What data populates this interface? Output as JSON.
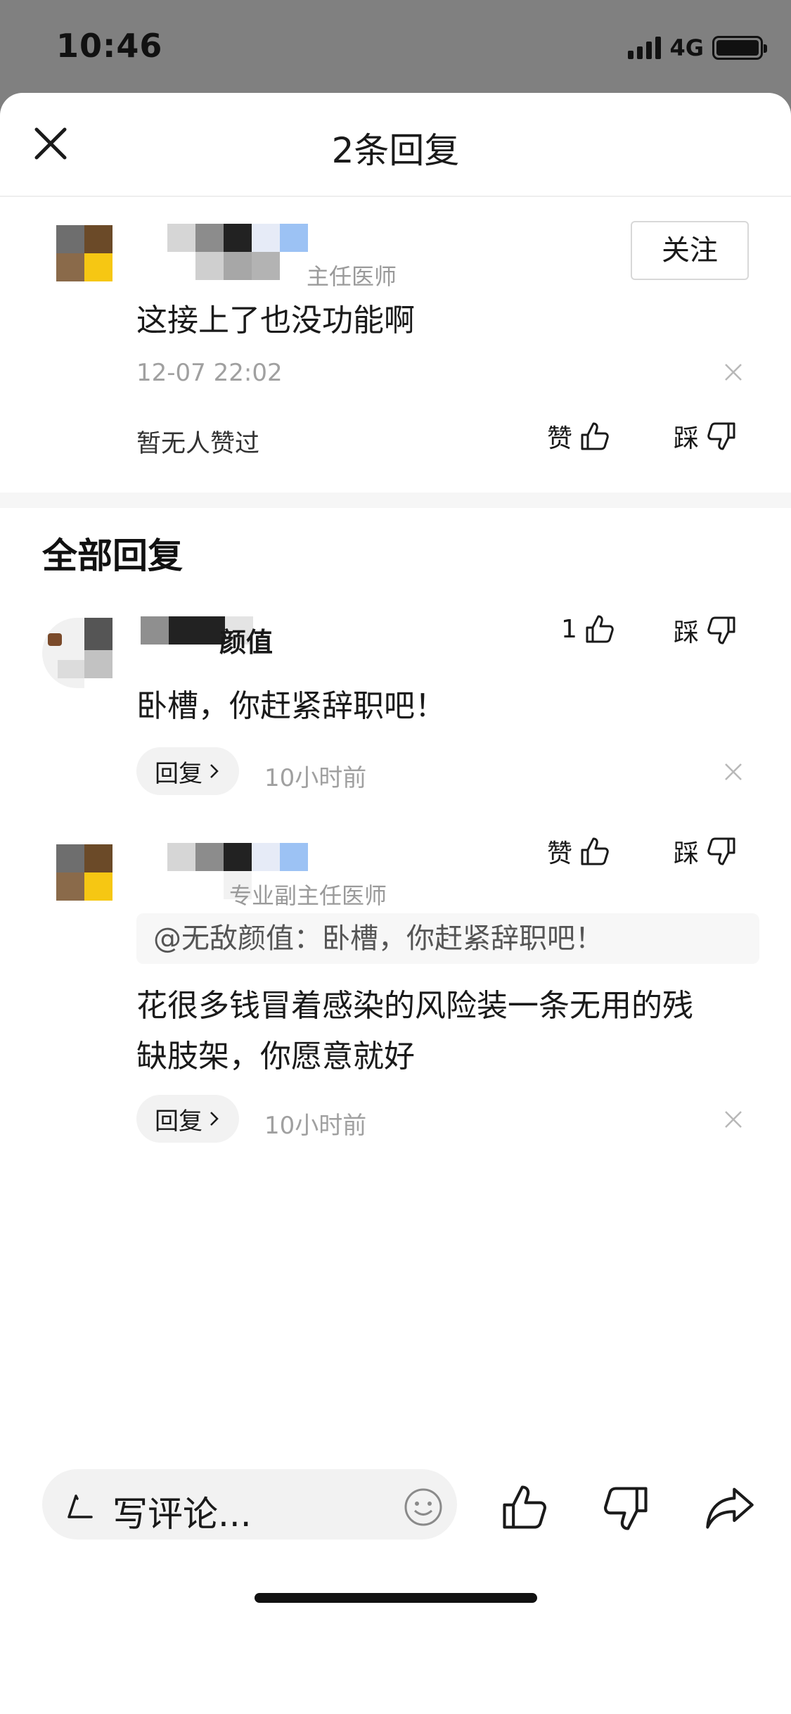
{
  "status_bar": {
    "time": "10:46",
    "network": "4G"
  },
  "sheet": {
    "title": "2条回复"
  },
  "top_comment": {
    "author_role": "主任医师",
    "follow_label": "关注",
    "text": "这接上了也没功能啊",
    "time": "12-07 22:02",
    "likes_text": "暂无人赞过",
    "like_label": "赞",
    "dislike_label": "踩"
  },
  "section_title": "全部回复",
  "replies": [
    {
      "author_suffix": "颜值",
      "like_count": "1",
      "dislike_label": "踩",
      "text": "卧槽，你赶紧辞职吧！",
      "reply_label": "回复",
      "time": "10小时前"
    },
    {
      "like_label": "赞",
      "dislike_label": "踩",
      "author_role": "专业副主任医师",
      "quote": "@无敌颜值：卧槽，你赶紧辞职吧！",
      "text_line1": "花很多钱冒着感染的风险装一条无用的残",
      "text_line2": "缺肢架，你愿意就好",
      "reply_label": "回复",
      "time": "10小时前"
    }
  ],
  "bottom_bar": {
    "input_placeholder": "写评论..."
  },
  "icons": {
    "close": "close-icon",
    "like": "thumbs-up-icon",
    "dislike": "thumbs-down-icon",
    "emoji": "emoji-icon",
    "share": "share-icon",
    "pen": "pen-icon",
    "dismiss": "dismiss-x-icon"
  }
}
